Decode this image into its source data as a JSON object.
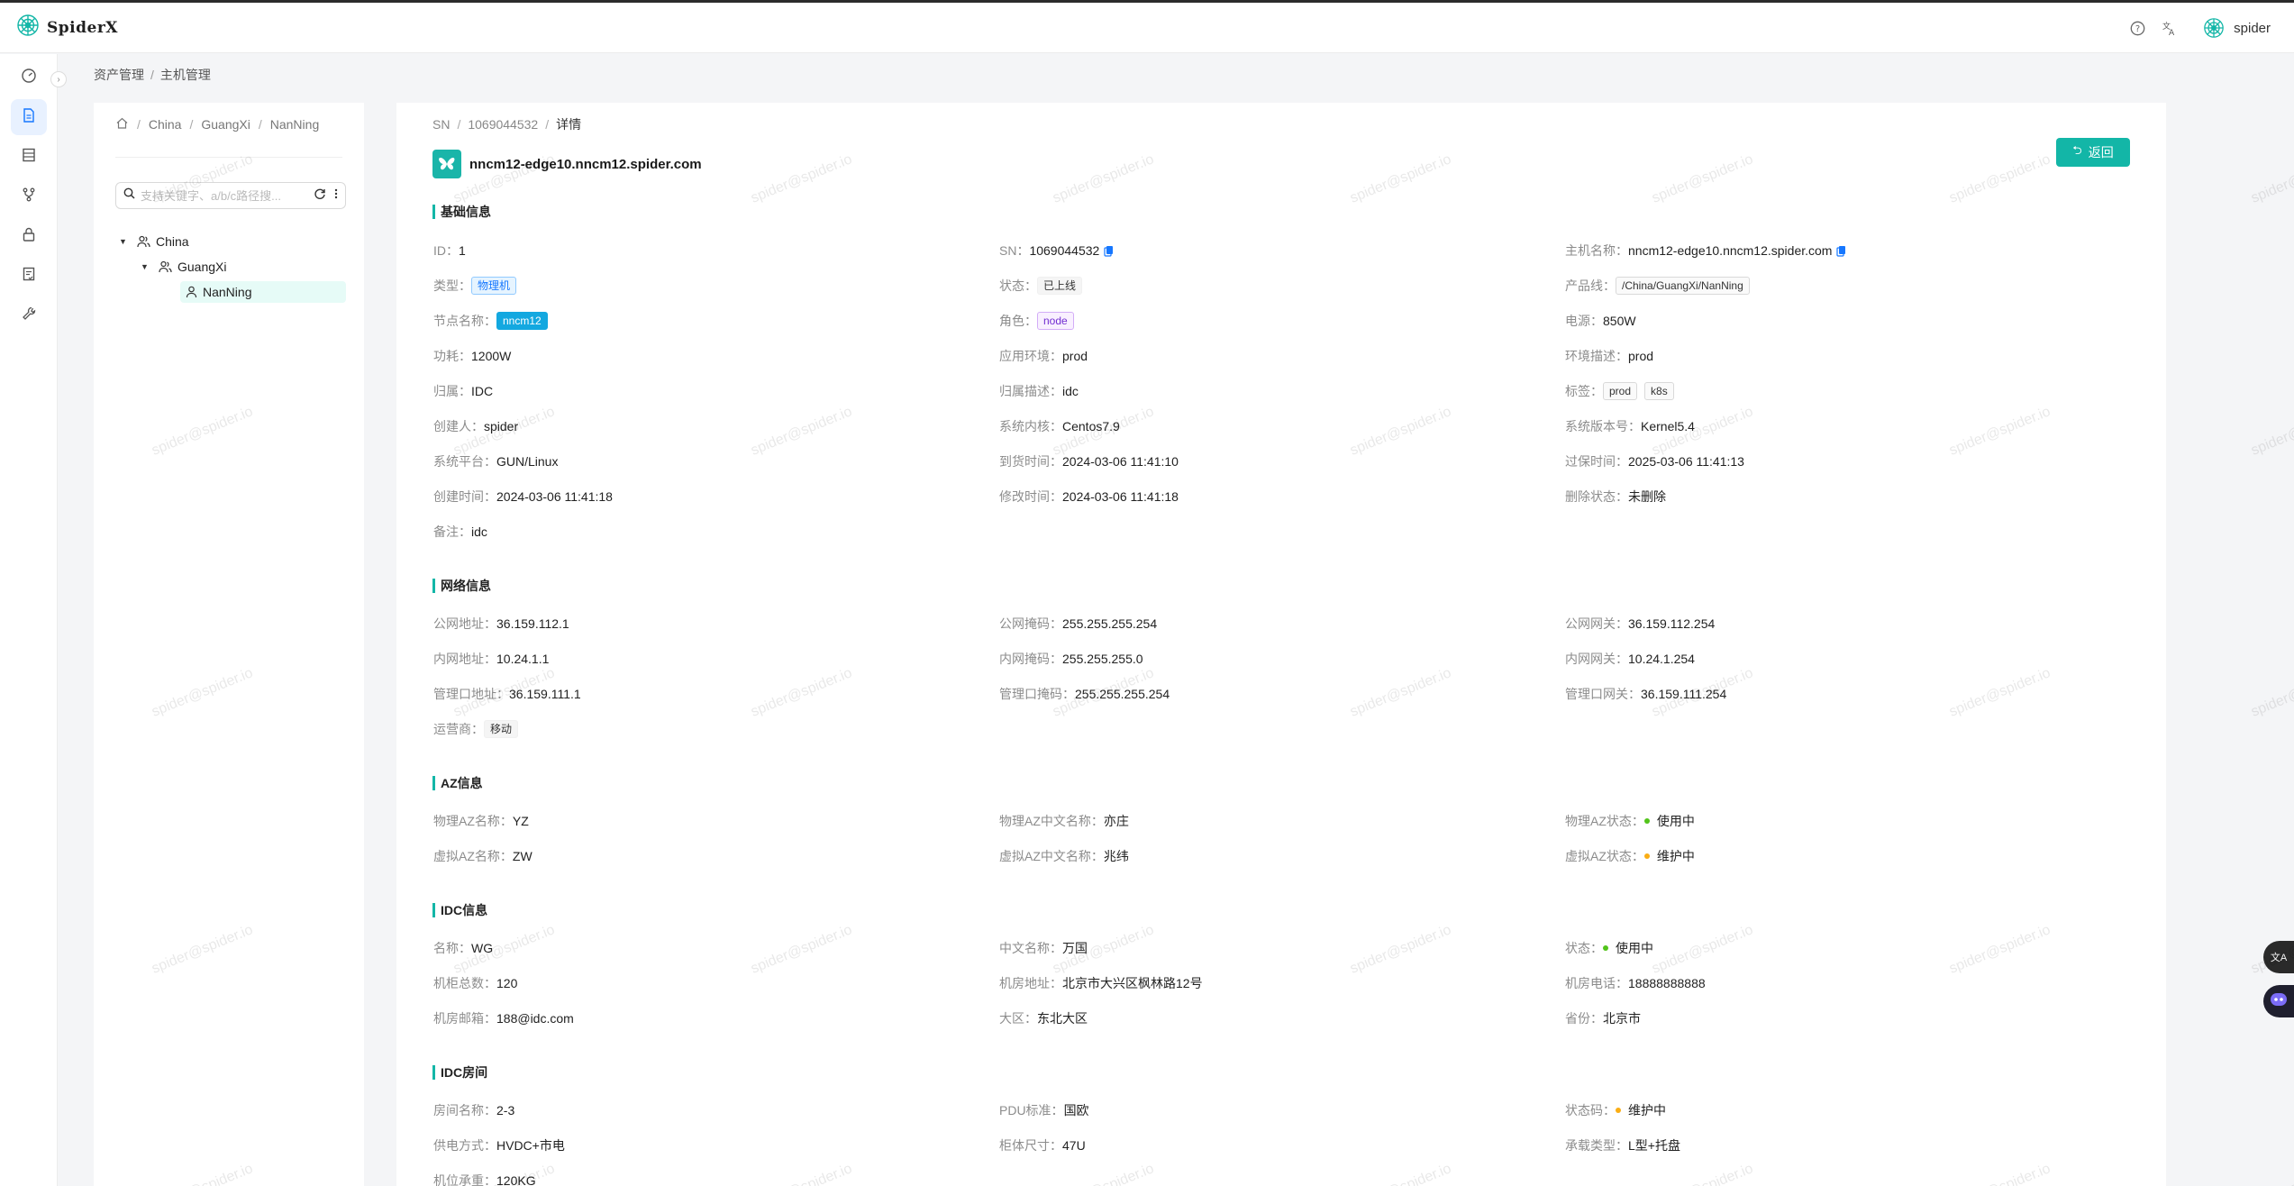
{
  "app": {
    "name": "SpiderX",
    "user": "spider",
    "accent": "#13b6a7"
  },
  "header": {
    "help_icon": "question-circle-icon",
    "lang_icon": "translate-icon"
  },
  "breadcrumb": [
    "资产管理",
    "主机管理"
  ],
  "tree": {
    "path": [
      "China",
      "GuangXi",
      "NanNing"
    ],
    "search_placeholder": "支持关键字、a/b/c路径搜...",
    "nodes": [
      {
        "label": "China",
        "level": 0
      },
      {
        "label": "GuangXi",
        "level": 1
      },
      {
        "label": "NanNing",
        "level": 2
      }
    ]
  },
  "detail": {
    "breadcrumb": {
      "root": "SN",
      "sn": "1069044532",
      "current": "详情"
    },
    "hostname": "nncm12-edge10.nncm12.spider.com",
    "back_label": "返回",
    "sections": {
      "basic": "基础信息",
      "network": "网络信息",
      "az": "AZ信息",
      "idc": "IDC信息",
      "room": "IDC房间"
    },
    "basic": {
      "id": {
        "label": "ID：",
        "value": "1"
      },
      "sn": {
        "label": "SN：",
        "value": "1069044532"
      },
      "hostname": {
        "label": "主机名称：",
        "value": "nncm12-edge10.nncm12.spider.com"
      },
      "type": {
        "label": "类型：",
        "value": "物理机"
      },
      "status": {
        "label": "状态：",
        "value": "已上线"
      },
      "product_line": {
        "label": "产品线：",
        "value": "/China/GuangXi/NanNing"
      },
      "node_name": {
        "label": "节点名称：",
        "value": "nncm12"
      },
      "role": {
        "label": "角色：",
        "value": "node"
      },
      "power": {
        "label": "电源：",
        "value": "850W"
      },
      "consumption": {
        "label": "功耗：",
        "value": "1200W"
      },
      "app_env": {
        "label": "应用环境：",
        "value": "prod"
      },
      "env_desc": {
        "label": "环境描述：",
        "value": "prod"
      },
      "owner": {
        "label": "归属：",
        "value": "IDC"
      },
      "owner_desc": {
        "label": "归属描述：",
        "value": "idc"
      },
      "tags": {
        "label": "标签：",
        "values": [
          "prod",
          "k8s"
        ]
      },
      "creator": {
        "label": "创建人：",
        "value": "spider"
      },
      "kernel": {
        "label": "系统内核：",
        "value": "Centos7.9"
      },
      "os_version": {
        "label": "系统版本号：",
        "value": "Kernel5.4"
      },
      "platform": {
        "label": "系统平台：",
        "value": "GUN/Linux"
      },
      "arrival": {
        "label": "到货时间：",
        "value": "2024-03-06 11:41:10"
      },
      "warranty": {
        "label": "过保时间：",
        "value": "2025-03-06 11:41:13"
      },
      "created": {
        "label": "创建时间：",
        "value": "2024-03-06 11:41:18"
      },
      "modified": {
        "label": "修改时间：",
        "value": "2024-03-06 11:41:18"
      },
      "deleted": {
        "label": "删除状态：",
        "value": "未删除"
      },
      "remark": {
        "label": "备注：",
        "value": "idc"
      }
    },
    "network": {
      "public_ip": {
        "label": "公网地址：",
        "value": "36.159.112.1"
      },
      "public_mask": {
        "label": "公网掩码：",
        "value": "255.255.255.254"
      },
      "public_gw": {
        "label": "公网网关：",
        "value": "36.159.112.254"
      },
      "private_ip": {
        "label": "内网地址：",
        "value": "10.24.1.1"
      },
      "private_mask": {
        "label": "内网掩码：",
        "value": "255.255.255.0"
      },
      "private_gw": {
        "label": "内网网关：",
        "value": "10.24.1.254"
      },
      "mgmt_ip": {
        "label": "管理口地址：",
        "value": "36.159.111.1"
      },
      "mgmt_mask": {
        "label": "管理口掩码：",
        "value": "255.255.255.254"
      },
      "mgmt_gw": {
        "label": "管理口网关：",
        "value": "36.159.111.254"
      },
      "isp": {
        "label": "运营商：",
        "value": "移动"
      }
    },
    "az": {
      "phys_name": {
        "label": "物理AZ名称：",
        "value": "YZ"
      },
      "phys_cn": {
        "label": "物理AZ中文名称：",
        "value": "亦庄"
      },
      "phys_status": {
        "label": "物理AZ状态：",
        "value": "使用中",
        "color": "#52c41a"
      },
      "virt_name": {
        "label": "虚拟AZ名称：",
        "value": "ZW"
      },
      "virt_cn": {
        "label": "虚拟AZ中文名称：",
        "value": "兆纬"
      },
      "virt_status": {
        "label": "虚拟AZ状态：",
        "value": "维护中",
        "color": "#faad14"
      }
    },
    "idc": {
      "name": {
        "label": "名称：",
        "value": "WG"
      },
      "cn_name": {
        "label": "中文名称：",
        "value": "万国"
      },
      "status": {
        "label": "状态：",
        "value": "使用中",
        "color": "#52c41a"
      },
      "racks": {
        "label": "机柜总数：",
        "value": "120"
      },
      "address": {
        "label": "机房地址：",
        "value": "北京市大兴区枫林路12号"
      },
      "phone": {
        "label": "机房电话：",
        "value": "18888888888"
      },
      "email": {
        "label": "机房邮箱：",
        "value": "188@idc.com"
      },
      "region": {
        "label": "大区：",
        "value": "东北大区"
      },
      "province": {
        "label": "省份：",
        "value": "北京市"
      }
    },
    "room": {
      "name": {
        "label": "房间名称：",
        "value": "2-3"
      },
      "pdu": {
        "label": "PDU标准：",
        "value": "国欧"
      },
      "status": {
        "label": "状态码：",
        "value": "维护中",
        "color": "#faad14"
      },
      "power_mode": {
        "label": "供电方式：",
        "value": "HVDC+市电"
      },
      "rack_size": {
        "label": "柜体尺寸：",
        "value": "47U"
      },
      "load_type": {
        "label": "承载类型：",
        "value": "L型+托盘"
      },
      "slot_load": {
        "label": "机位承重：",
        "value": "120KG"
      }
    }
  },
  "watermark": "spider@spider.io",
  "rail_icons": [
    "dashboard-icon",
    "document-icon",
    "table-icon",
    "branch-icon",
    "lock-icon",
    "report-icon",
    "tool-icon"
  ]
}
